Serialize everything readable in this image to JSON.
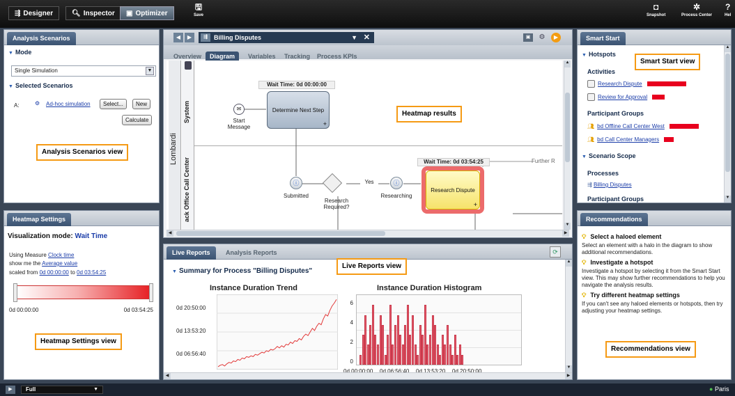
{
  "topbar": {
    "tabs": [
      {
        "label": "Designer"
      },
      {
        "label": "Inspector"
      },
      {
        "label": "Optimizer"
      }
    ],
    "save_label": "Save",
    "snapshot_label": "Snapshot",
    "process_center_label": "Process Center",
    "help_label": "Hel"
  },
  "analysis": {
    "title": "Analysis Scenarios",
    "mode_label": "Mode",
    "mode_value": "Single Simulation",
    "selected_label": "Selected Scenarios",
    "row_prefix": "A:",
    "scenario": "Ad-hoc simulation",
    "select_btn": "Select...",
    "new_btn": "New",
    "calc_btn": "Calculate",
    "callout": "Analysis Scenarios view"
  },
  "heatmap": {
    "title": "Heatmap Settings",
    "mode_prefix": "Visualization mode:",
    "mode_value": "Wait Time",
    "using_prefix": "Using Measure",
    "using_value": "Clock time",
    "show_prefix": "show me the",
    "show_value": "Average value",
    "scaled_prefix": "scaled from",
    "from": "0d 00:00:00",
    "to_word": "to",
    "to": "0d 03:54:25",
    "min_label": "0d 00:00:00",
    "max_label": "0d 03:54:25",
    "callout": "Heatmap Settings view"
  },
  "editor": {
    "process_title": "Billing Disputes",
    "tabs": [
      "Overview",
      "Diagram",
      "Variables",
      "Tracking",
      "Process KPIs"
    ],
    "pool": "Lombardi",
    "lane_system": "System",
    "lane_back": "ack Office Call Center",
    "wait1": "Wait Time: 0d 00:00:00",
    "wait2": "Wait Time: 0d 03:54:25",
    "further": "Further R",
    "start_label": "Start\nMessage",
    "determine": "Determine Next Step",
    "submitted": "Submitted",
    "research_required": "Research Required?",
    "yes": "Yes",
    "researching": "Researching",
    "research_dispute": "Research Dispute",
    "callout": "Heatmap results"
  },
  "reports": {
    "tab_live": "Live Reports",
    "tab_analysis": "Analysis Reports",
    "summary": "Summary for Process \"Billing Disputes\"",
    "callout": "Live Reports view"
  },
  "smartstart": {
    "title": "Smart Start",
    "hotspots": "Hotspots",
    "activities": "Activities",
    "activity_items": [
      {
        "label": "Research Dispute",
        "value": 1.0
      },
      {
        "label": "Review for Approval",
        "value": 0.32
      }
    ],
    "participant_groups": "Participant Groups",
    "group_items": [
      {
        "label": "bd Offline Call Center West",
        "value": 1.0
      },
      {
        "label": "bd Call Center Managers",
        "value": 0.33
      }
    ],
    "scenario_scope": "Scenario Scope",
    "processes": "Processes",
    "process_item": "Billing Disputes",
    "participant_groups_cut": "Participant Groups",
    "callout": "Smart Start view"
  },
  "recommendations": {
    "title": "Recommendations",
    "items": [
      {
        "heading": "Select a haloed element",
        "text": "Select an element with a halo in the diagram to show additional recommendations."
      },
      {
        "heading": "Investigate a hotspot",
        "text": "Investigate a hotspot by selecting it from the Smart Start view. This may show further recommendations to help you navigate the analysis results."
      },
      {
        "heading": "Try different heatmap settings",
        "text": "If you can't see any haloed elements or hotspots, then try adjusting your heatmap settings."
      }
    ],
    "callout": "Recommendations view"
  },
  "statusbar": {
    "view_value": "Full",
    "user": "Paris"
  },
  "colors": {
    "accent": "#f59a14",
    "hot": "#e8001e",
    "panel_tab": "#3b5372"
  },
  "chart_data": [
    {
      "type": "line",
      "title": "Instance Duration Trend",
      "yticks": [
        "0d 20:50:00",
        "0d 13:53:20",
        "0d 06:56:40",
        "0d 00:00:00"
      ],
      "series": [
        {
          "values": [
            0.02,
            0.04,
            0.05,
            0.03,
            0.06,
            0.08,
            0.07,
            0.1,
            0.09,
            0.12,
            0.11,
            0.14,
            0.13,
            0.16,
            0.15,
            0.17,
            0.16,
            0.19,
            0.18,
            0.2,
            0.22,
            0.21,
            0.24,
            0.23,
            0.26,
            0.25,
            0.27,
            0.3,
            0.28,
            0.31,
            0.29,
            0.33,
            0.32,
            0.36,
            0.34,
            0.38,
            0.37,
            0.41,
            0.39,
            0.44,
            0.47,
            0.45,
            0.5,
            0.55,
            0.52,
            0.58,
            0.62,
            0.6,
            0.68,
            0.74,
            0.72,
            0.8,
            0.86,
            0.9,
            0.95
          ]
        }
      ],
      "ylim": [
        0,
        1
      ]
    },
    {
      "type": "bar",
      "title": "Instance Duration Histogram",
      "xticks": [
        "0d 00:00:00",
        "0d 06:56:40",
        "0d 13:53:20",
        "0d 20:50:00"
      ],
      "yticks": [
        "6",
        "4",
        "2",
        "0"
      ],
      "values": [
        1,
        3,
        5,
        2,
        4,
        6,
        3,
        2,
        5,
        4,
        1,
        3,
        6,
        2,
        4,
        5,
        3,
        2,
        4,
        6,
        3,
        5,
        2,
        1,
        4,
        3,
        6,
        2,
        3,
        5,
        4,
        2,
        1,
        3,
        2,
        4,
        2,
        1,
        3,
        1,
        2,
        1
      ],
      "ylim": [
        0,
        7
      ]
    }
  ]
}
